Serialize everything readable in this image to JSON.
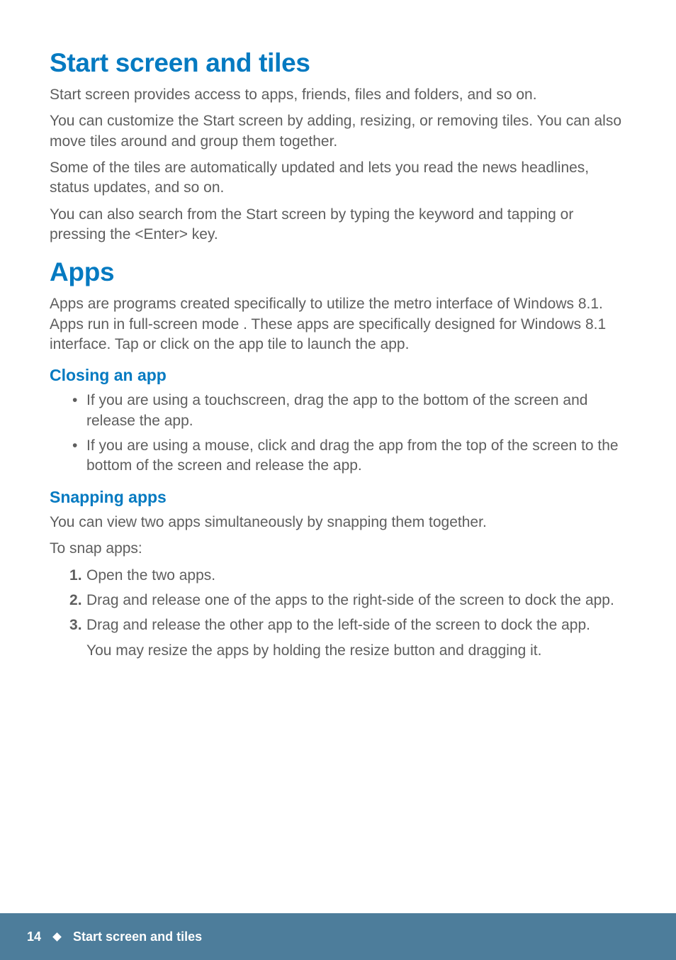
{
  "section1": {
    "heading": "Start screen and tiles",
    "p1": "Start screen provides access to apps, friends, files and folders, and so on.",
    "p2": "You can customize the Start screen by adding, resizing, or removing tiles. You can also move tiles around and group them together.",
    "p3": "Some of the tiles are automatically updated and lets you read the news headlines, status updates, and so on.",
    "p4": "You can also search from the Start screen by typing the keyword and tapping or pressing the <Enter> key."
  },
  "section2": {
    "heading": "Apps",
    "p1": "Apps are programs created specifically to utilize the metro interface of Windows 8.1. Apps run in full-screen mode . These apps are specifically designed for Windows 8.1 interface. Tap or click on the app tile to launch the app.",
    "sub1": {
      "heading": "Closing an app",
      "bullets": [
        "If you are using a touchscreen, drag the app to the bottom of the screen and release the app.",
        "If you are using a mouse, click and drag the app from the top of the screen to the bottom of the screen and release the app."
      ]
    },
    "sub2": {
      "heading": "Snapping apps",
      "p1": "You can view two apps simultaneously by snapping them together.",
      "p2": "To snap apps:",
      "steps": [
        "Open the two apps.",
        "Drag and release one of the apps to the right-side of the screen to dock the app.",
        "Drag and release the other app to the left-side of the screen to dock the app."
      ],
      "note": "You may resize the apps by holding the resize button and dragging it."
    }
  },
  "footer": {
    "page": "14",
    "title": "Start screen and tiles"
  }
}
